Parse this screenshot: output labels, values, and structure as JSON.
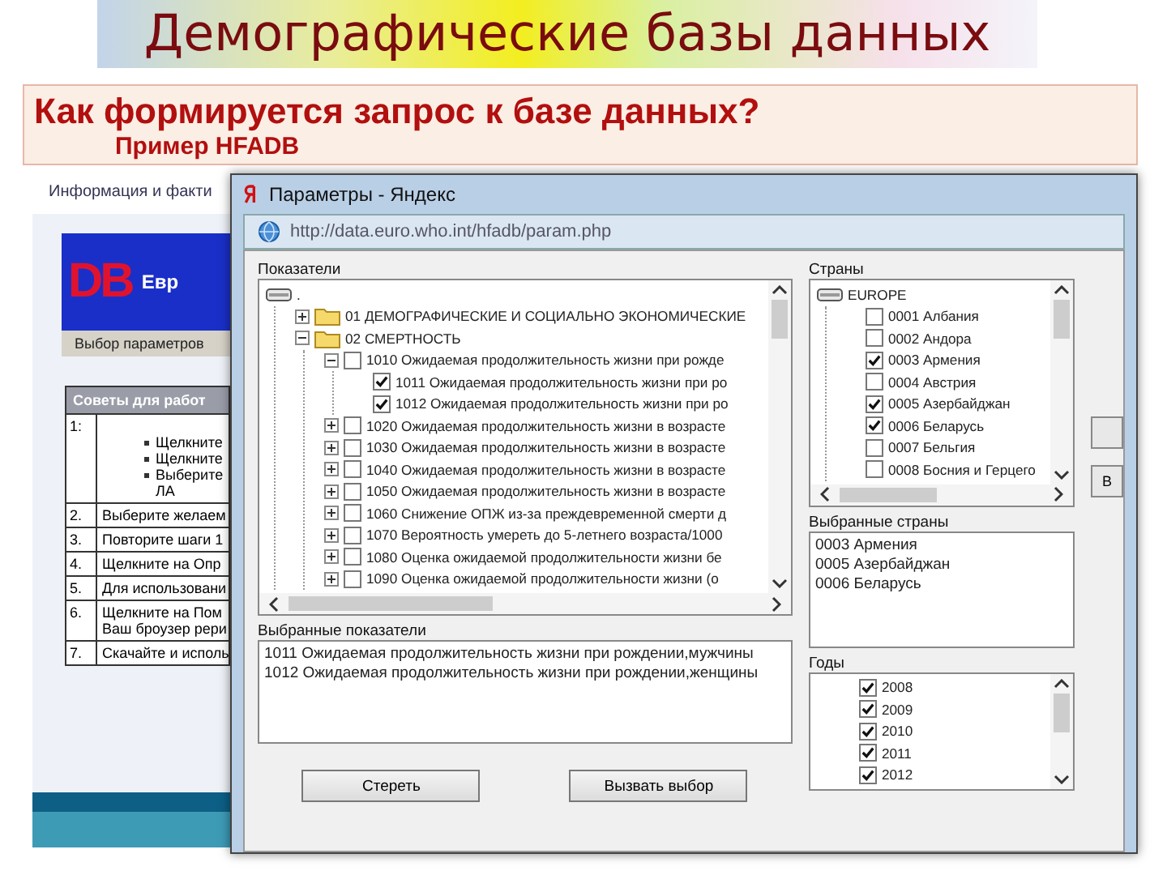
{
  "slide": {
    "title": "Демографические базы данных",
    "subtitle": "Как формируется запрос к базе данных?",
    "subtitle_line_2": "Пример HFADB"
  },
  "background_page": {
    "header": "Информация и факти",
    "logo_text": "DB",
    "banner_text": "Евр",
    "tab": "Выбор параметров",
    "tips_heading": "Советы для работ",
    "tips": [
      {
        "number": "1:",
        "bullets": [
          "Щелкните",
          "Щелкните",
          "Выберите"
        ],
        "continuation": "ЛА"
      },
      {
        "number": "2.",
        "lines": [
          "Выберите желаем"
        ]
      },
      {
        "number": "3.",
        "lines": [
          "Повторите шаги 1"
        ]
      },
      {
        "number": "4.",
        "lines": [
          "Щелкните на Опр"
        ]
      },
      {
        "number": "5.",
        "lines": [
          "Для использовани"
        ]
      },
      {
        "number": "6.",
        "lines": [
          "Щелкните на Пом",
          "Ваш броузер рери"
        ]
      },
      {
        "number": "7.",
        "lines": [
          "Скачайте и исполь"
        ]
      }
    ]
  },
  "dialog": {
    "title": "Параметры - Яндекс",
    "address": "http://data.euro.who.int/hfadb/param.php",
    "indicators": {
      "label": "Показатели",
      "tree": {
        "kind": "root",
        "label": ".",
        "children": [
          {
            "kind": "folder",
            "label": "01 ДЕМОГРАФИЧЕСКИЕ И СОЦИАЛЬНО ЭКОНОМИЧЕСКИЕ",
            "expanded": false
          },
          {
            "kind": "folder",
            "label": "02 СМЕРТНОСТЬ",
            "expanded": true,
            "children": [
              {
                "label": "1010 Ожидаемая продолжительность жизни при рожде",
                "expanded": true,
                "checked": false,
                "children": [
                  {
                    "label": "1011 Ожидаемая продолжительность жизни при ро",
                    "checked": true
                  },
                  {
                    "label": "1012 Ожидаемая продолжительность жизни при ро",
                    "checked": true
                  }
                ]
              },
              {
                "label": "1020 Ожидаемая продолжительность жизни в возрасте",
                "expanded": false,
                "checked": false
              },
              {
                "label": "1030 Ожидаемая продолжительность жизни в возрасте",
                "expanded": false,
                "checked": false
              },
              {
                "label": "1040 Ожидаемая продолжительность жизни в возрасте",
                "expanded": false,
                "checked": false
              },
              {
                "label": "1050 Ожидаемая продолжительность жизни в возрасте",
                "expanded": false,
                "checked": false
              },
              {
                "label": "1060 Снижение ОПЖ из-за преждевременной смерти д",
                "expanded": false,
                "checked": false
              },
              {
                "label": "1070 Вероятность умереть до 5-летнего возраста/1000",
                "expanded": false,
                "checked": false
              },
              {
                "label": "1080 Оценка ожидаемой продолжительности жизни бе",
                "expanded": false,
                "checked": false
              },
              {
                "label": "1090 Оценка ожидаемой продолжительности жизни (о",
                "expanded": false,
                "checked": false
              }
            ]
          }
        ]
      }
    },
    "selected_indicators": {
      "label": "Выбранные показатели",
      "lines": [
        "1011 Ожидаемая продолжительность жизни при рождении,мужчины",
        "1012 Ожидаемая продолжительность жизни при рождении,женщины"
      ]
    },
    "buttons": [
      "Стереть",
      "Вызвать выбор"
    ],
    "countries": {
      "label": "Страны",
      "tree": {
        "kind": "root",
        "label": "EUROPE",
        "children": [
          {
            "label": "0001 Албания",
            "checked": false
          },
          {
            "label": "0002 Андора",
            "checked": false
          },
          {
            "label": "0003 Армения",
            "checked": true
          },
          {
            "label": "0004 Австрия",
            "checked": false
          },
          {
            "label": "0005 Азербайджан",
            "checked": true
          },
          {
            "label": "0006 Беларусь",
            "checked": true
          },
          {
            "label": "0007 Бельгия",
            "checked": false
          },
          {
            "label": "0008 Босния и Герцего",
            "checked": false
          }
        ]
      }
    },
    "selected_countries": {
      "label": "Выбранные страны",
      "lines": [
        "0003 Армения",
        "0005 Азербайджан",
        "0006 Беларусь"
      ]
    },
    "years": {
      "label": "Годы",
      "items": [
        {
          "label": "2008",
          "checked": true
        },
        {
          "label": "2009",
          "checked": true
        },
        {
          "label": "2010",
          "checked": true
        },
        {
          "label": "2011",
          "checked": true
        },
        {
          "label": "2012",
          "checked": true
        }
      ]
    },
    "side_button": "В"
  }
}
